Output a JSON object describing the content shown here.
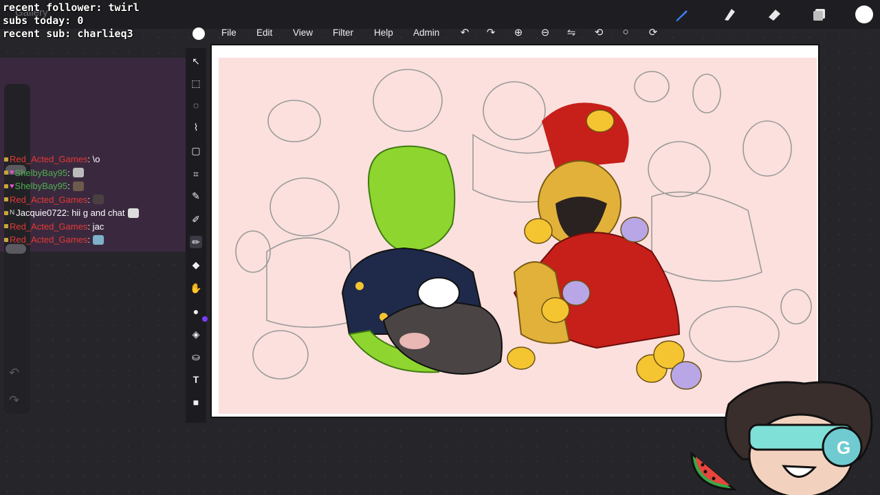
{
  "overlay": {
    "line1": "recent follower: twirl",
    "line2": "subs today: 0",
    "line3": "recent sub: charlieq3"
  },
  "topbar": {
    "gallery_label": "Gallery",
    "icons": [
      "brush-icon",
      "smudge-icon",
      "eraser-icon",
      "layers-icon",
      "color-swatch-icon"
    ]
  },
  "menu": {
    "items": [
      "File",
      "Edit",
      "View",
      "Filter",
      "Help",
      "Admin"
    ]
  },
  "menu_tools": [
    "undo-icon",
    "redo-icon",
    "zoom-in-icon",
    "zoom-out-icon",
    "flip-icon",
    "rotate-icon",
    "circle-icon",
    "symmetry-icon"
  ],
  "chat": {
    "messages": [
      {
        "user": "Red_Acted_Games",
        "user_color": "#e53935",
        "text": ": \\o",
        "heart": false,
        "emote": ""
      },
      {
        "user": "ShelbyBay95",
        "user_color": "#4caf50",
        "text": ": ",
        "heart": true,
        "emote": "cat"
      },
      {
        "user": "ShelbyBay95",
        "user_color": "#4caf50",
        "text": ": ",
        "heart": true,
        "emote": "dog"
      },
      {
        "user": "Red_Acted_Games",
        "user_color": "#e53935",
        "text": ": ",
        "heart": false,
        "emote": "dog"
      },
      {
        "user": "Jacquie0722",
        "user_color": "#ffffff",
        "text": ": hii g and chat ",
        "heart": false,
        "emote": "cat"
      },
      {
        "user": "Red_Acted_Games",
        "user_color": "#e53935",
        "text": ": jac",
        "heart": false,
        "emote": "star"
      },
      {
        "user": "Red_Acted_Games",
        "user_color": "#e53935",
        "text": ": ",
        "heart": false,
        "emote": "fish"
      }
    ]
  },
  "left_tools": [
    "selection-arrow-icon",
    "rect-select-icon",
    "lasso-circle-icon",
    "lasso-icon",
    "transform-icon",
    "crop-icon",
    "eyedropper-icon",
    "pen-icon",
    "brush-icon",
    "eraser-icon",
    "smudge-icon",
    "color-blob-icon",
    "fill-icon",
    "stamp-icon",
    "text-icon",
    "square-icon"
  ],
  "accent_color": "#7a3cff",
  "canvas_bg_color": "#fbe0dd"
}
